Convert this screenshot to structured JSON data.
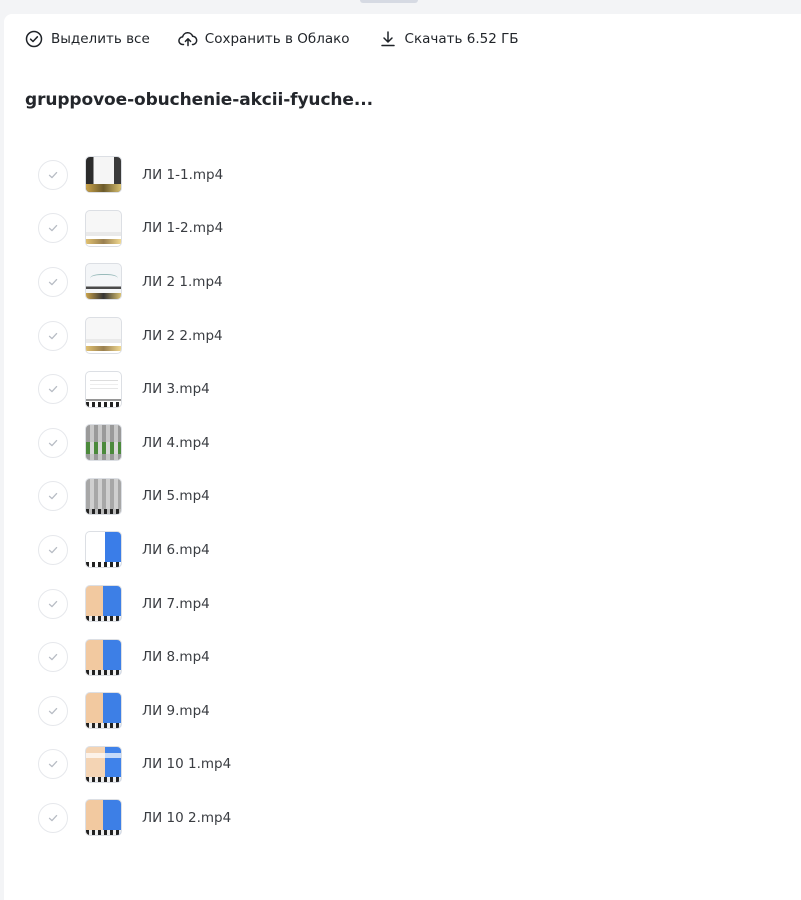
{
  "toolbar": {
    "select_all_label": "Выделить все",
    "save_to_cloud_label": "Сохранить в Облако",
    "download_label": "Скачать 6.52 ГБ"
  },
  "folder": {
    "title": "gruppovoe-obuchenie-akcii-fyuche..."
  },
  "files": [
    {
      "name": "ЛИ 1-1.mp4",
      "thumb": "dark"
    },
    {
      "name": "ЛИ 1-2.mp4",
      "thumb": "light"
    },
    {
      "name": "ЛИ 2 1.mp4",
      "thumb": "chart"
    },
    {
      "name": "ЛИ 2 2.mp4",
      "thumb": "light"
    },
    {
      "name": "ЛИ 3.mp4",
      "thumb": "white"
    },
    {
      "name": "ЛИ 4.mp4",
      "thumb": "green"
    },
    {
      "name": "ЛИ 5.mp4",
      "thumb": "grey"
    },
    {
      "name": "ЛИ 6.mp4",
      "thumb": "blue"
    },
    {
      "name": "ЛИ 7.mp4",
      "thumb": "peach"
    },
    {
      "name": "ЛИ 8.mp4",
      "thumb": "peach"
    },
    {
      "name": "ЛИ 9.mp4",
      "thumb": "peach"
    },
    {
      "name": "ЛИ 10 1.mp4",
      "thumb": "peach2"
    },
    {
      "name": "ЛИ 10 2.mp4",
      "thumb": "peach"
    }
  ],
  "colors": {
    "text": "#1f2328",
    "check_icon": "#b7bcc4",
    "background": "#f3f4f6",
    "panel": "#ffffff"
  },
  "icons": {
    "select_all": "check-circle-icon",
    "save_to_cloud": "cloud-upload-icon",
    "download": "download-icon",
    "file_check": "checkmark-icon"
  }
}
